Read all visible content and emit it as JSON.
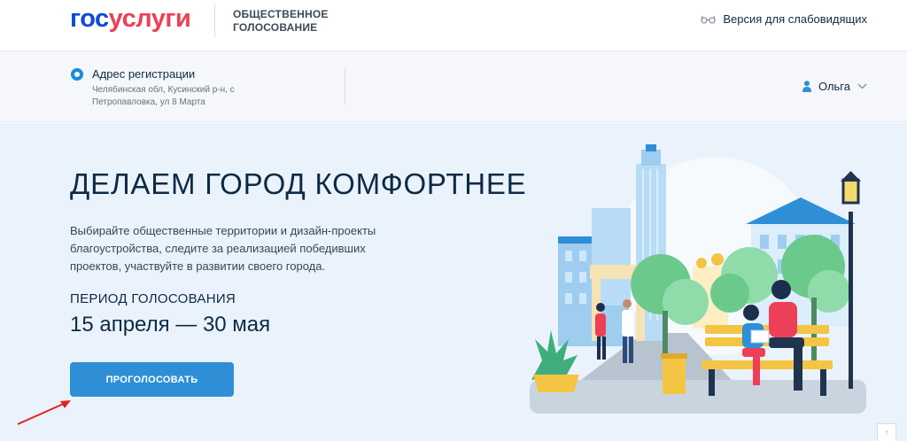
{
  "header": {
    "logo_part1": "гос",
    "logo_part2": "услуги",
    "service_line1": "ОБЩЕСТВЕННОЕ",
    "service_line2": "ГОЛОСОВАНИЕ",
    "low_vision_label": "Версия для слабовидящих",
    "low_vision_icon": "glasses-icon"
  },
  "address": {
    "title": "Адрес регистрации",
    "text": "Челябинская обл, Кусинский р-н, с Петропавловка, ул 8 Марта"
  },
  "user": {
    "name": "Ольга",
    "icon": "person-icon"
  },
  "hero": {
    "title": "ДЕЛАЕМ ГОРОД КОМФОРТНЕЕ",
    "description": "Выбирайте общественные территории и дизайн-проекты благоустройства, следите за реализацией победивших проектов, участвуйте в развитии своего города.",
    "period_label": "ПЕРИОД ГОЛОСОВАНИЯ",
    "period_dates": "15 апреля — 30 мая",
    "vote_button": "ПРОГОЛОСОВАТЬ"
  },
  "colors": {
    "brand_blue": "#0d4cd3",
    "brand_red": "#ee3f58",
    "button_blue": "#2e8fd6",
    "hero_bg": "#eaf3fb",
    "annotation_arrow": "#e0221b"
  }
}
